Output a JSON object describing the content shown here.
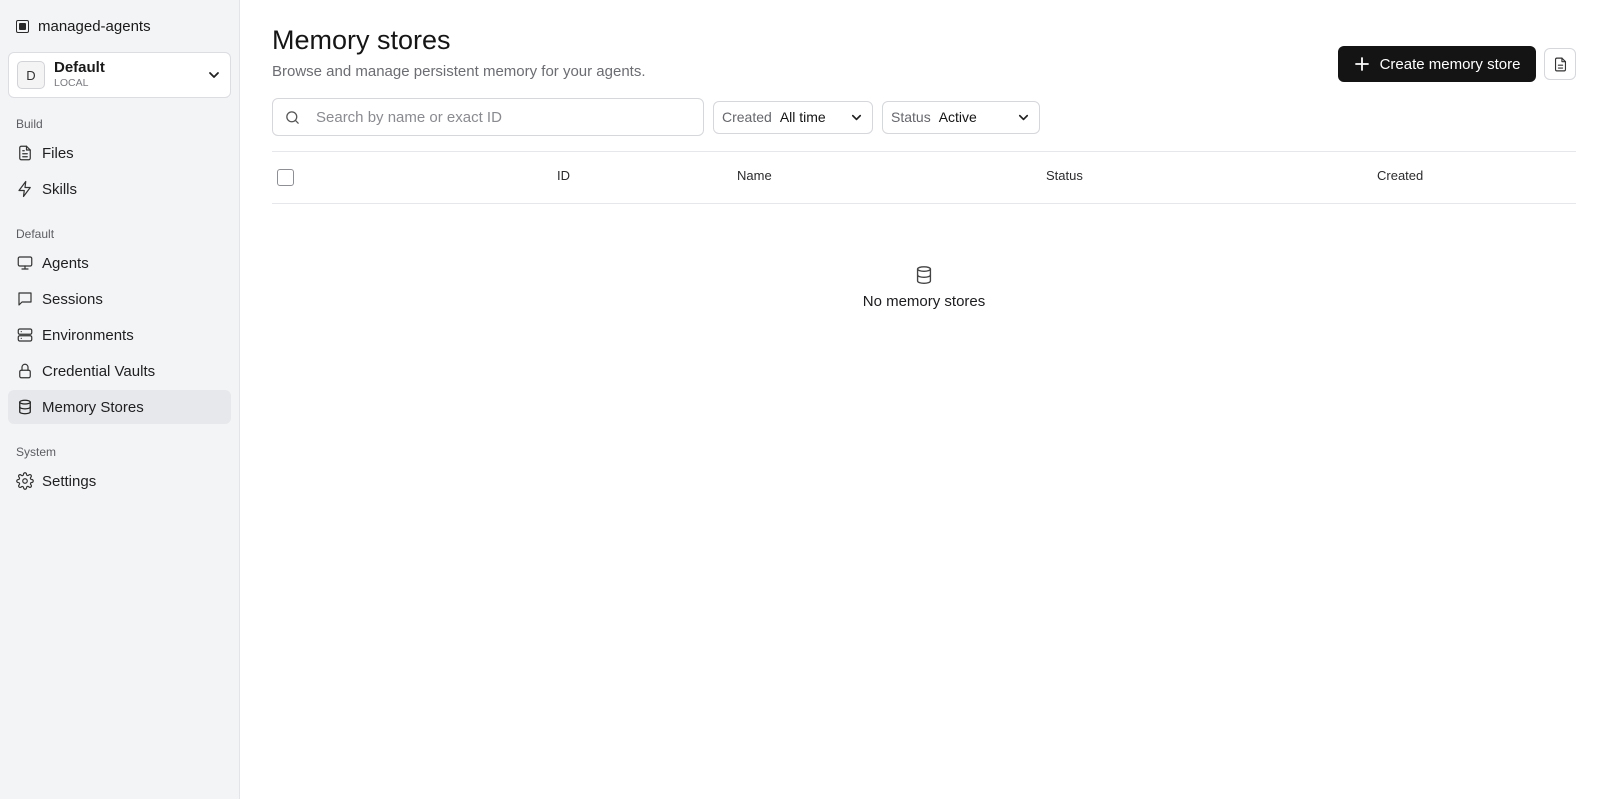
{
  "app": {
    "name": "managed-agents"
  },
  "workspace": {
    "initial": "D",
    "name": "Default",
    "env": "LOCAL"
  },
  "sidebar": {
    "sections": [
      {
        "label": "Build",
        "items": [
          {
            "label": "Files",
            "icon": "file-icon"
          },
          {
            "label": "Skills",
            "icon": "lightning-icon"
          }
        ]
      },
      {
        "label": "Default",
        "items": [
          {
            "label": "Agents",
            "icon": "monitor-icon"
          },
          {
            "label": "Sessions",
            "icon": "chat-icon"
          },
          {
            "label": "Environments",
            "icon": "server-icon"
          },
          {
            "label": "Credential Vaults",
            "icon": "lock-icon"
          },
          {
            "label": "Memory Stores",
            "icon": "database-icon",
            "active": true
          }
        ]
      },
      {
        "label": "System",
        "items": [
          {
            "label": "Settings",
            "icon": "gear-icon"
          }
        ]
      }
    ]
  },
  "page": {
    "title": "Memory stores",
    "subtitle": "Browse and manage persistent memory for your agents.",
    "create_button": "Create memory store"
  },
  "filters": {
    "search_placeholder": "Search by name or exact ID",
    "created_label": "Created",
    "created_value": "All time",
    "status_label": "Status",
    "status_value": "Active"
  },
  "table": {
    "columns": [
      "ID",
      "Name",
      "Status",
      "Created"
    ],
    "rows": []
  },
  "empty_state": {
    "text": "No memory stores",
    "icon": "database-icon"
  }
}
